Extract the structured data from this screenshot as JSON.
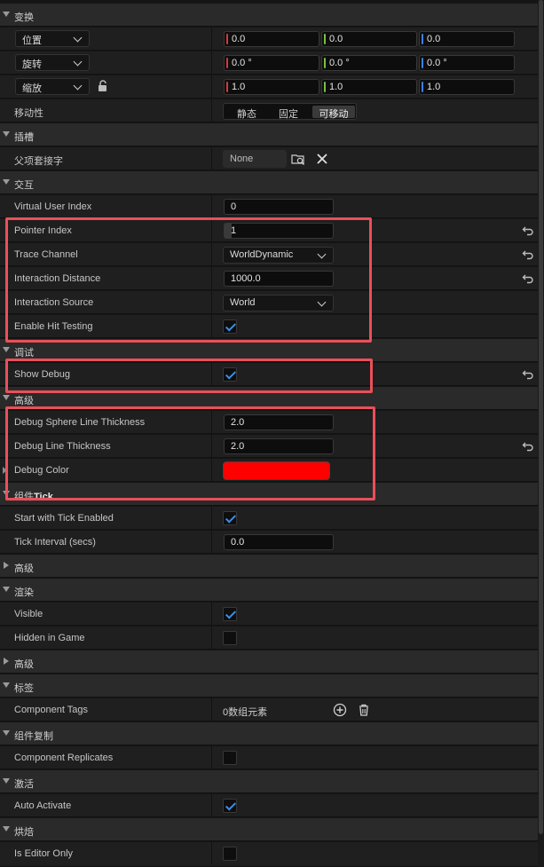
{
  "categories": {
    "transform": "变换",
    "sockets": "插槽",
    "interaction": "交互",
    "debug": "调试",
    "advanced1": "高级",
    "component_tick_prefix": "组件",
    "component_tick_suffix": "Tick",
    "advanced2": "高级",
    "rendering": "渲染",
    "advanced3": "高级",
    "tags": "标签",
    "replication": "组件复制",
    "activation": "激活",
    "cooking": "烘焙"
  },
  "transform": {
    "location": {
      "label": "位置",
      "x": "0.0",
      "y": "0.0",
      "z": "0.0"
    },
    "rotation": {
      "label": "旋转",
      "x": "0.0 °",
      "y": "0.0 °",
      "z": "0.0 °"
    },
    "scale": {
      "label": "缩放",
      "x": "1.0",
      "y": "1.0",
      "z": "1.0"
    },
    "mobility": {
      "label": "移动性",
      "options": [
        "静态",
        "固定",
        "可移动"
      ],
      "selected": "可移动"
    }
  },
  "sockets": {
    "parent_socket": {
      "label": "父项套接字",
      "value": "None"
    }
  },
  "interaction": {
    "virtual_user_index": {
      "label": "Virtual User Index",
      "value": "0"
    },
    "pointer_index": {
      "label": "Pointer Index",
      "value": "1"
    },
    "trace_channel": {
      "label": "Trace Channel",
      "value": "WorldDynamic"
    },
    "interaction_distance": {
      "label": "Interaction Distance",
      "value": "1000.0"
    },
    "interaction_source": {
      "label": "Interaction Source",
      "value": "World"
    },
    "enable_hit_testing": {
      "label": "Enable Hit Testing",
      "checked": true
    }
  },
  "debug": {
    "show_debug": {
      "label": "Show Debug",
      "checked": true
    }
  },
  "advanced": {
    "debug_sphere_line_thickness": {
      "label": "Debug Sphere Line Thickness",
      "value": "2.0"
    },
    "debug_line_thickness": {
      "label": "Debug Line Thickness",
      "value": "2.0"
    },
    "debug_color": {
      "label": "Debug Color",
      "color": "#ff0000"
    }
  },
  "tick": {
    "start_with_tick_enabled": {
      "label": "Start with Tick Enabled",
      "checked": true
    },
    "tick_interval": {
      "label": "Tick Interval (secs)",
      "value": "0.0"
    }
  },
  "rendering": {
    "visible": {
      "label": "Visible",
      "checked": true
    },
    "hidden_in_game": {
      "label": "Hidden in Game",
      "checked": false
    }
  },
  "tags": {
    "component_tags": {
      "label": "Component Tags",
      "value": "0数组元素"
    }
  },
  "replication": {
    "component_replicates": {
      "label": "Component Replicates",
      "checked": false
    }
  },
  "activation": {
    "auto_activate": {
      "label": "Auto Activate",
      "checked": true
    }
  },
  "cooking": {
    "is_editor_only": {
      "label": "Is Editor Only",
      "checked": false
    }
  },
  "colors": {
    "highlight": "#e9505a",
    "check": "#3d8ee8",
    "axis_x": "#d13b3b",
    "axis_y": "#7ac143",
    "axis_z": "#3f7fe0"
  }
}
